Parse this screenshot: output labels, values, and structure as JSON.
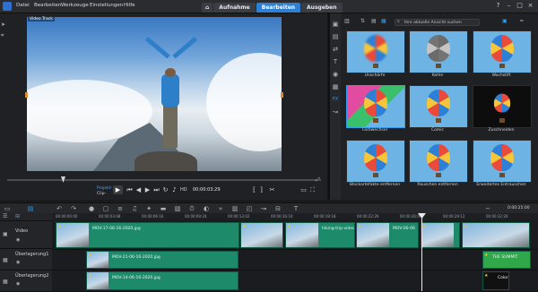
{
  "menu": [
    "Datei",
    "Bearbeiten",
    "Werkzeuge",
    "Einstellungen",
    "Hilfe"
  ],
  "mode_tabs": {
    "home_icon": "home-icon",
    "capture": "Aufnahme",
    "edit": "Bearbeiten",
    "share": "Ausgeben",
    "active": "Bearbeiten"
  },
  "player": {
    "video_tag": "Video Track",
    "project_label": "Projekt-",
    "clip_label": "Clip-",
    "timecode": "00:00:03:29"
  },
  "library": {
    "search_placeholder": "Ihre aktuelle Ansicht suchen",
    "items": [
      {
        "label": "Unschärfe"
      },
      {
        "label": "Kohle"
      },
      {
        "label": "Wachstift"
      },
      {
        "label": "Farbwechsel"
      },
      {
        "label": "Comic"
      },
      {
        "label": "Zuschneiden"
      },
      {
        "label": "Blockartefakte entfernen"
      },
      {
        "label": "Rauschen entfernen"
      },
      {
        "label": "Erweitertes Entrauschen"
      }
    ]
  },
  "timeline": {
    "zoom_label": "0:00:25:00",
    "ruler": [
      "00:00:00:00",
      "00:00:03:08",
      "00:00:06:16",
      "00:00:09:24",
      "00:00:13:02",
      "00:00:16:10",
      "00:00:19:18",
      "00:00:22:26",
      "00:00:26:04",
      "00:00:29:12",
      "00:00:32:20"
    ],
    "tracks": [
      "Video",
      "Überlagerung1",
      "Überlagerung2"
    ],
    "video_clips": [
      {
        "label": "MOV-17-06-16-2020.jpg"
      },
      {
        "label": ""
      },
      {
        "label": "hiking-trip-video"
      },
      {
        "label": "MOV-06-06"
      },
      {
        "label": ""
      },
      {
        "label": ""
      }
    ],
    "overlay1_clips": [
      {
        "label": "MOV-21-06-16-2020.jpg"
      },
      {
        "label": "THE SUMMIT"
      }
    ],
    "overlay2_clips": [
      {
        "label": "MOV-14-06-16-2020.jpg"
      },
      {
        "label": "Color"
      }
    ]
  },
  "colors": {
    "accent": "#2e7fd6",
    "clip": "#1d8a6a",
    "panel": "#202124"
  }
}
